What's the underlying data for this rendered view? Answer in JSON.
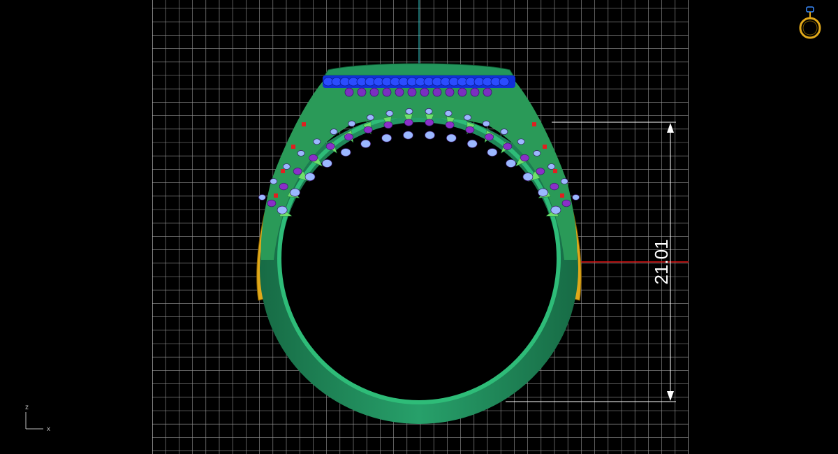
{
  "viewport": {
    "view": "Front",
    "background": "#000000",
    "grid_color": "#9a9a9a",
    "grid_major_color": "#d0d0d0",
    "axis_y_color": "#2fd0d0",
    "axis_x_color": "#e01010"
  },
  "dimension": {
    "value": "21.01",
    "color": "#ffffff"
  },
  "axis_triad": {
    "z_label": "z",
    "x_label": "x"
  },
  "model": {
    "name": "ring",
    "band_color": "#1f8a5a",
    "band_light": "#2fae72",
    "prong_color": "#3ec060",
    "top_color": "#1030d8",
    "stone_color": "#9bb8ff",
    "bead_color": "#8a2fc8",
    "side_gold": "#e0a81a",
    "accent_red": "#e02020"
  },
  "widget": {
    "icon": "ring-icon",
    "color": "#e0a81a"
  }
}
